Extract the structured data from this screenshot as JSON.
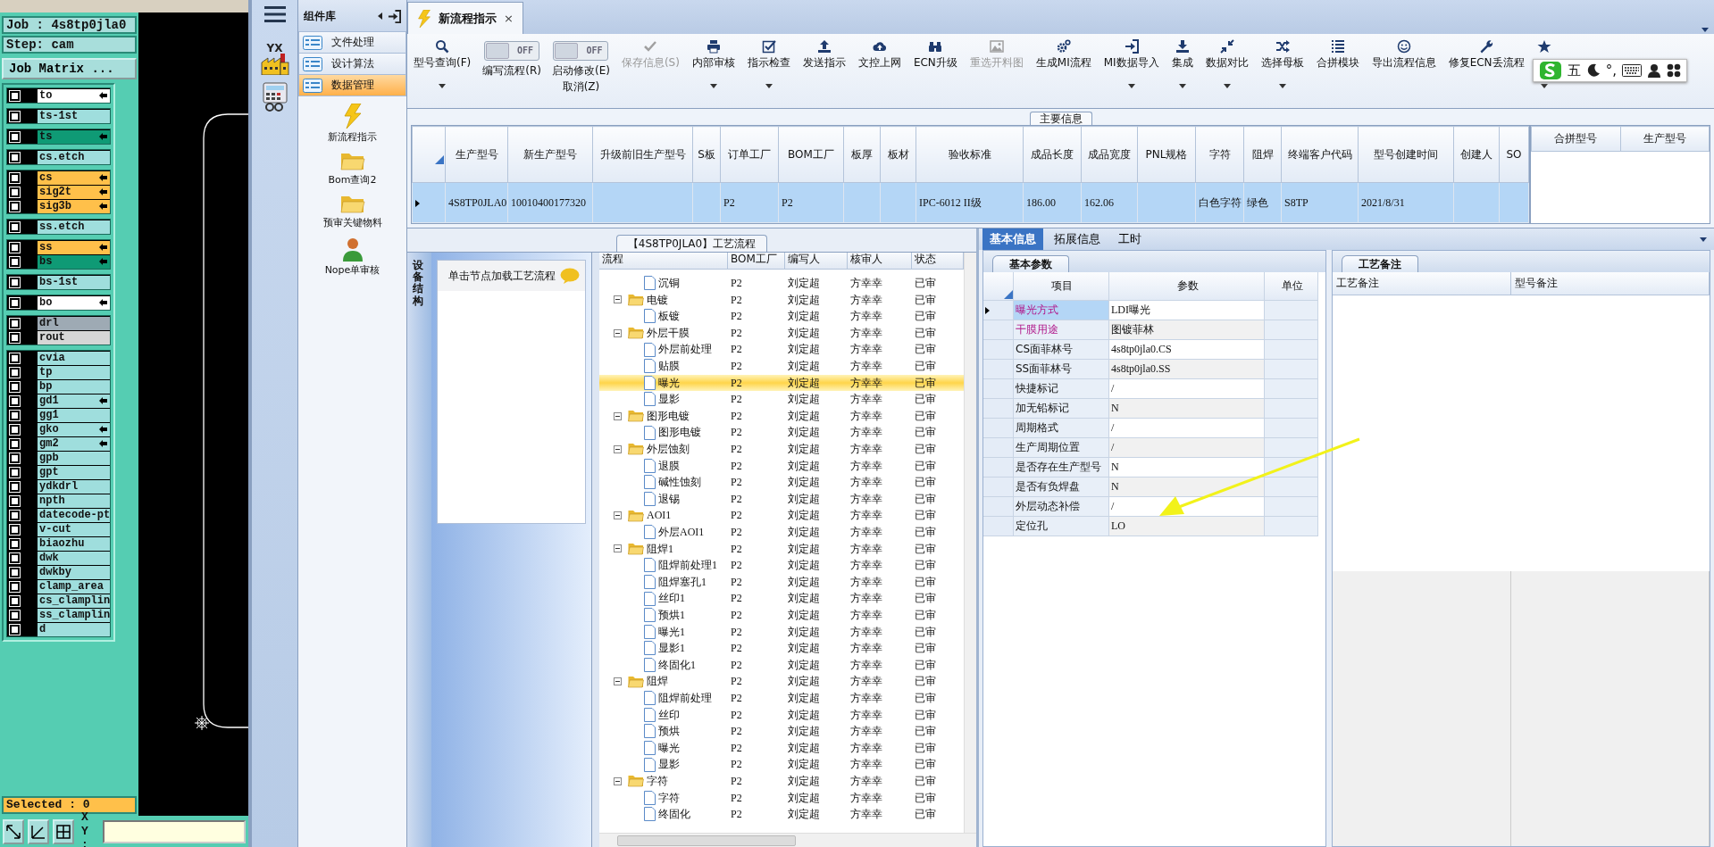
{
  "cam": {
    "job": "Job : 4s8tp0jla0",
    "step": "Step: cam",
    "matrix_button": "Job Matrix ...",
    "layer_groups": [
      [
        {
          "name": "to",
          "color": "#ffffff",
          "pointer": true,
          "checked": false
        }
      ],
      [
        {
          "name": "ts-1st",
          "color": "#9fdedd",
          "pointer": false,
          "checked": false
        }
      ],
      [
        {
          "name": "ts",
          "color": "#0f9a75",
          "pointer": true,
          "checked": false
        }
      ],
      [
        {
          "name": "cs.etch",
          "color": "#9fdedd",
          "pointer": false,
          "checked": false
        }
      ],
      [
        {
          "name": "cs",
          "color": "#ffc04a",
          "pointer": true,
          "checked": false
        },
        {
          "name": "sig2t",
          "color": "#ffc04a",
          "pointer": true,
          "checked": false
        },
        {
          "name": "sig3b",
          "color": "#ffc04a",
          "pointer": true,
          "checked": false
        }
      ],
      [
        {
          "name": "ss.etch",
          "color": "#9fdedd",
          "pointer": false,
          "checked": false
        }
      ],
      [
        {
          "name": "ss",
          "color": "#ffc04a",
          "pointer": true,
          "checked": false
        },
        {
          "name": "bs",
          "color": "#0f9a75",
          "pointer": true,
          "checked": false
        }
      ],
      [
        {
          "name": "bs-1st",
          "color": "#9fdedd",
          "pointer": false,
          "checked": false
        }
      ],
      [
        {
          "name": "bo",
          "color": "#ffffff",
          "pointer": true,
          "checked": false
        }
      ],
      [
        {
          "name": "drl",
          "color": "#9eaab4",
          "pointer": false,
          "checked": false
        },
        {
          "name": "rout",
          "color": "#d6d6d6",
          "pointer": false,
          "checked": false
        }
      ],
      [
        {
          "name": "cvia",
          "color": "#9fdedd",
          "pointer": false,
          "checked": false
        },
        {
          "name": "tp",
          "color": "#9fdedd",
          "pointer": false,
          "checked": false
        },
        {
          "name": "bp",
          "color": "#9fdedd",
          "pointer": false,
          "checked": false
        },
        {
          "name": "gd1",
          "color": "#9fdedd",
          "pointer": true,
          "checked": false
        },
        {
          "name": "gg1",
          "color": "#9fdedd",
          "pointer": false,
          "checked": false
        },
        {
          "name": "gko",
          "color": "#9fdedd",
          "pointer": true,
          "checked": false
        },
        {
          "name": "gm2",
          "color": "#9fdedd",
          "pointer": true,
          "checked": false
        },
        {
          "name": "gpb",
          "color": "#9fdedd",
          "pointer": false,
          "checked": false
        },
        {
          "name": "gpt",
          "color": "#9fdedd",
          "pointer": false,
          "checked": false
        },
        {
          "name": "ydkdrl",
          "color": "#9fdedd",
          "pointer": false,
          "checked": false
        },
        {
          "name": "npth",
          "color": "#9fdedd",
          "pointer": false,
          "checked": false
        },
        {
          "name": "datecode-pt",
          "color": "#9fdedd",
          "pointer": false,
          "checked": false
        },
        {
          "name": "v-cut",
          "color": "#9fdedd",
          "pointer": false,
          "checked": false
        },
        {
          "name": "biaozhu",
          "color": "#9fdedd",
          "pointer": false,
          "checked": false
        },
        {
          "name": "dwk",
          "color": "#9fdedd",
          "pointer": false,
          "checked": false
        },
        {
          "name": "dwkby",
          "color": "#9fdedd",
          "pointer": false,
          "checked": false
        },
        {
          "name": "clamp_area",
          "color": "#9fdedd",
          "pointer": false,
          "checked": false
        },
        {
          "name": "cs_clamplin",
          "color": "#9fdedd",
          "pointer": false,
          "checked": false
        },
        {
          "name": "ss_clamplin",
          "color": "#9fdedd",
          "pointer": false,
          "checked": false
        },
        {
          "name": "d",
          "color": "#9fdedd",
          "pointer": false,
          "checked": false
        }
      ]
    ],
    "selected_text": "Selected : 0",
    "xy_label": "X Y :"
  },
  "app": {
    "logo_text": "YX",
    "library": {
      "title": "组件库",
      "categories": [
        {
          "label": "文件处理",
          "selected": false
        },
        {
          "label": "设计算法",
          "selected": false
        },
        {
          "label": "数据管理",
          "selected": true
        }
      ],
      "modules": [
        {
          "label": "新流程指示",
          "kind": "lightning"
        },
        {
          "label": "Bom查询2",
          "kind": "folder"
        },
        {
          "label": "预审关键物料",
          "kind": "folder"
        },
        {
          "label": "Nope单审核",
          "kind": "person"
        }
      ]
    },
    "tabs": [
      {
        "label": "新流程指示",
        "selected": true,
        "close": "×"
      }
    ],
    "toolbar": [
      {
        "kind": "button",
        "label": "型号查询(F)",
        "dropdown": true,
        "disabled": false
      },
      {
        "kind": "toggle",
        "text": "OFF",
        "on": false,
        "label": "编写流程(R)"
      },
      {
        "kind": "toggle",
        "text": "OFF",
        "on": false,
        "label": "启动修改(E)",
        "sublabel": "取消(Z)"
      },
      {
        "kind": "button",
        "label": "保存信息(S)",
        "dropdown": false,
        "disabled": true
      },
      {
        "kind": "button",
        "label": "内部审核",
        "dropdown": true,
        "disabled": false
      },
      {
        "kind": "button",
        "label": "指示检查",
        "dropdown": true,
        "disabled": false
      },
      {
        "kind": "button",
        "label": "发送指示",
        "dropdown": false,
        "disabled": false
      },
      {
        "kind": "button",
        "label": "文控上网",
        "dropdown": false,
        "disabled": false
      },
      {
        "kind": "button",
        "label": "ECN升级",
        "dropdown": false,
        "disabled": false
      },
      {
        "kind": "button",
        "label": "重选开料图",
        "dropdown": false,
        "disabled": true
      },
      {
        "kind": "button",
        "label": "生成MI流程",
        "dropdown": false,
        "disabled": false
      },
      {
        "kind": "button",
        "label": "MI数据导入",
        "dropdown": true,
        "disabled": false
      },
      {
        "kind": "button",
        "label": "集成",
        "dropdown": true,
        "disabled": false
      },
      {
        "kind": "button",
        "label": "数据对比",
        "dropdown": true,
        "disabled": false
      },
      {
        "kind": "button",
        "label": "选择母板",
        "dropdown": true,
        "disabled": false
      },
      {
        "kind": "button",
        "label": "合拼模块",
        "dropdown": false,
        "disabled": false
      },
      {
        "kind": "button",
        "label": "导出流程信息",
        "dropdown": false,
        "disabled": false
      },
      {
        "kind": "button",
        "label": "修复ECN丢流程",
        "dropdown": false,
        "disabled": false
      },
      {
        "kind": "button",
        "dropdown": true,
        "disabled": false
      }
    ],
    "ime": {
      "layout_text": "五",
      "punct_text": "°,"
    },
    "main_info": {
      "title": "主要信息",
      "columns": [
        "生产型号",
        "新生产型号",
        "升级前旧生产型号",
        "S板",
        "订单工厂",
        "BOM工厂",
        "板厚",
        "板材",
        "验收标准",
        "成品长度",
        "成品宽度",
        "PNL规格",
        "字符",
        "阻焊",
        "终端客户代码",
        "型号创建时间",
        "创建人",
        "SO"
      ],
      "rows": [
        {
          "selected": true,
          "cells": [
            "4S8TP0JLA0",
            "10010400177320",
            null,
            null,
            "P2",
            "P2",
            null,
            null,
            "IPC-6012 II级",
            "186.00",
            "162.06",
            null,
            "白色字符",
            "绿色",
            "S8TP",
            "2021/8/31",
            null,
            null
          ]
        }
      ],
      "side_columns": [
        "合拼型号",
        "生产型号"
      ]
    },
    "process": {
      "title": "【4S8TP0JLA0】工艺流程",
      "side_tab": "设备结构",
      "hint": "单击节点加载工艺流程",
      "columns": [
        "流程",
        "BOM工厂",
        "编写人",
        "核审人",
        "状态"
      ],
      "nodes": [
        {
          "kind": "doc",
          "label": "沉铜",
          "bom": "P2",
          "writer": "刘定超",
          "reviewer": "方幸幸",
          "status": "已审",
          "selected": false
        },
        {
          "kind": "folder",
          "label": "电镀",
          "bom": "P2",
          "writer": "刘定超",
          "reviewer": "方幸幸",
          "status": "已审",
          "selected": false,
          "expanded": true,
          "children": [
            {
              "kind": "doc",
              "label": "板镀",
              "bom": "P2",
              "writer": "刘定超",
              "reviewer": "方幸幸",
              "status": "已审",
              "selected": false
            }
          ]
        },
        {
          "kind": "folder",
          "label": "外层干膜",
          "bom": "P2",
          "writer": "刘定超",
          "reviewer": "方幸幸",
          "status": "已审",
          "selected": false,
          "expanded": true,
          "children": [
            {
              "kind": "doc",
              "label": "外层前处理",
              "bom": "P2",
              "writer": "刘定超",
              "reviewer": "方幸幸",
              "status": "已审",
              "selected": false
            },
            {
              "kind": "doc",
              "label": "贴膜",
              "bom": "P2",
              "writer": "刘定超",
              "reviewer": "方幸幸",
              "status": "已审",
              "selected": false
            },
            {
              "kind": "doc",
              "label": "曝光",
              "bom": "P2",
              "writer": "刘定超",
              "reviewer": "方幸幸",
              "status": "已审",
              "selected": true
            },
            {
              "kind": "doc",
              "label": "显影",
              "bom": "P2",
              "writer": "刘定超",
              "reviewer": "方幸幸",
              "status": "已审",
              "selected": false
            }
          ]
        },
        {
          "kind": "folder",
          "label": "图形电镀",
          "bom": "P2",
          "writer": "刘定超",
          "reviewer": "方幸幸",
          "status": "已审",
          "selected": false,
          "expanded": true,
          "children": [
            {
              "kind": "doc",
              "label": "图形电镀",
              "bom": "P2",
              "writer": "刘定超",
              "reviewer": "方幸幸",
              "status": "已审",
              "selected": false
            }
          ]
        },
        {
          "kind": "folder",
          "label": "外层蚀刻",
          "bom": "P2",
          "writer": "刘定超",
          "reviewer": "方幸幸",
          "status": "已审",
          "selected": false,
          "expanded": true,
          "children": [
            {
              "kind": "doc",
              "label": "退膜",
              "bom": "P2",
              "writer": "刘定超",
              "reviewer": "方幸幸",
              "status": "已审",
              "selected": false
            },
            {
              "kind": "doc",
              "label": "碱性蚀刻",
              "bom": "P2",
              "writer": "刘定超",
              "reviewer": "方幸幸",
              "status": "已审",
              "selected": false
            },
            {
              "kind": "doc",
              "label": "退锡",
              "bom": "P2",
              "writer": "刘定超",
              "reviewer": "方幸幸",
              "status": "已审",
              "selected": false
            }
          ]
        },
        {
          "kind": "folder",
          "label": "AOI1",
          "bom": "P2",
          "writer": "刘定超",
          "reviewer": "方幸幸",
          "status": "已审",
          "selected": false,
          "expanded": true,
          "children": [
            {
              "kind": "doc",
              "label": "外层AOI1",
              "bom": "P2",
              "writer": "刘定超",
              "reviewer": "方幸幸",
              "status": "已审",
              "selected": false
            }
          ]
        },
        {
          "kind": "folder",
          "label": "阻焊1",
          "bom": "P2",
          "writer": "刘定超",
          "reviewer": "方幸幸",
          "status": "已审",
          "selected": false,
          "expanded": true,
          "children": [
            {
              "kind": "doc",
              "label": "阻焊前处理1",
              "bom": "P2",
              "writer": "刘定超",
              "reviewer": "方幸幸",
              "status": "已审",
              "selected": false
            },
            {
              "kind": "doc",
              "label": "阻焊塞孔1",
              "bom": "P2",
              "writer": "刘定超",
              "reviewer": "方幸幸",
              "status": "已审",
              "selected": false
            },
            {
              "kind": "doc",
              "label": "丝印1",
              "bom": "P2",
              "writer": "刘定超",
              "reviewer": "方幸幸",
              "status": "已审",
              "selected": false
            },
            {
              "kind": "doc",
              "label": "预烘1",
              "bom": "P2",
              "writer": "刘定超",
              "reviewer": "方幸幸",
              "status": "已审",
              "selected": false
            },
            {
              "kind": "doc",
              "label": "曝光1",
              "bom": "P2",
              "writer": "刘定超",
              "reviewer": "方幸幸",
              "status": "已审",
              "selected": false
            },
            {
              "kind": "doc",
              "label": "显影1",
              "bom": "P2",
              "writer": "刘定超",
              "reviewer": "方幸幸",
              "status": "已审",
              "selected": false
            },
            {
              "kind": "doc",
              "label": "终固化1",
              "bom": "P2",
              "writer": "刘定超",
              "reviewer": "方幸幸",
              "status": "已审",
              "selected": false
            }
          ]
        },
        {
          "kind": "folder",
          "label": "阻焊",
          "bom": "P2",
          "writer": "刘定超",
          "reviewer": "方幸幸",
          "status": "已审",
          "selected": false,
          "expanded": true,
          "children": [
            {
              "kind": "doc",
              "label": "阻焊前处理",
              "bom": "P2",
              "writer": "刘定超",
              "reviewer": "方幸幸",
              "status": "已审",
              "selected": false
            },
            {
              "kind": "doc",
              "label": "丝印",
              "bom": "P2",
              "writer": "刘定超",
              "reviewer": "方幸幸",
              "status": "已审",
              "selected": false
            },
            {
              "kind": "doc",
              "label": "预烘",
              "bom": "P2",
              "writer": "刘定超",
              "reviewer": "方幸幸",
              "status": "已审",
              "selected": false
            },
            {
              "kind": "doc",
              "label": "曝光",
              "bom": "P2",
              "writer": "刘定超",
              "reviewer": "方幸幸",
              "status": "已审",
              "selected": false
            },
            {
              "kind": "doc",
              "label": "显影",
              "bom": "P2",
              "writer": "刘定超",
              "reviewer": "方幸幸",
              "status": "已审",
              "selected": false
            }
          ]
        },
        {
          "kind": "folder",
          "label": "字符",
          "bom": "P2",
          "writer": "刘定超",
          "reviewer": "方幸幸",
          "status": "已审",
          "selected": false,
          "expanded": true,
          "children": [
            {
              "kind": "doc",
              "label": "字符",
              "bom": "P2",
              "writer": "刘定超",
              "reviewer": "方幸幸",
              "status": "已审",
              "selected": false
            },
            {
              "kind": "doc",
              "label": "终固化",
              "bom": "P2",
              "writer": "刘定超",
              "reviewer": "方幸幸",
              "status": "已审",
              "selected": false
            }
          ]
        }
      ]
    },
    "details": {
      "tabs": [
        {
          "label": "基本信息",
          "selected": true
        },
        {
          "label": "拓展信息",
          "selected": false
        },
        {
          "label": "工时",
          "selected": false
        }
      ],
      "params_title": "基本参数",
      "param_columns": [
        "项目",
        "参数",
        "单位"
      ],
      "params": [
        {
          "item": "曝光方式",
          "value": "LDI曝光",
          "highlighted": true,
          "selected": true
        },
        {
          "item": "干膜用途",
          "value": "图镀菲林",
          "highlighted": true,
          "selected": false
        },
        {
          "item": "CS面菲林号",
          "value": "4s8tp0jla0.CS",
          "highlighted": false,
          "selected": false
        },
        {
          "item": "SS面菲林号",
          "value": "4s8tp0jla0.SS",
          "highlighted": false,
          "selected": false
        },
        {
          "item": "快捷标记",
          "value": "/",
          "highlighted": false,
          "selected": false
        },
        {
          "item": "加无铅标记",
          "value": "N",
          "highlighted": false,
          "selected": false
        },
        {
          "item": "周期格式",
          "value": "/",
          "highlighted": false,
          "selected": false
        },
        {
          "item": "生产周期位置",
          "value": "/",
          "highlighted": false,
          "selected": false
        },
        {
          "item": "是否存在生产型号",
          "value": "N",
          "highlighted": false,
          "selected": false
        },
        {
          "item": "是否有负焊盘",
          "value": "N",
          "highlighted": false,
          "selected": false
        },
        {
          "item": "外层动态补偿",
          "value": "/",
          "highlighted": false,
          "selected": false
        },
        {
          "item": "定位孔",
          "value": "LO",
          "highlighted": false,
          "selected": false
        }
      ],
      "notes_title": "工艺备注",
      "note_columns": [
        "工艺备注",
        "型号备注"
      ]
    }
  }
}
